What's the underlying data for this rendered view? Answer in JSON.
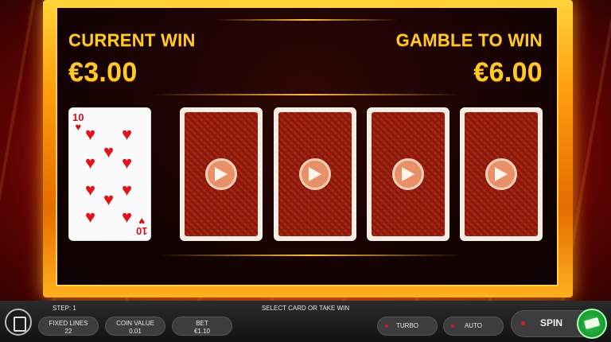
{
  "header": {
    "current_win_label": "CURRENT WIN",
    "current_win_value": "€3.00",
    "gamble_label": "GAMBLE TO WIN",
    "gamble_value": "€6.00"
  },
  "dealer_card": {
    "rank": "10",
    "suit": "hearts",
    "suit_symbol": "♥"
  },
  "face_down_cards": 4,
  "bottom_bar": {
    "step": "STEP: 1",
    "message": "SELECT CARD OR TAKE WIN",
    "fixed_lines_label": "FIXED LINES",
    "fixed_lines_value": "22",
    "coin_value_label": "COIN VALUE",
    "coin_value_value": "0.01",
    "bet_label": "BET",
    "bet_value": "€1.10",
    "turbo_label": "TURBO",
    "auto_label": "AUTO",
    "spin_label": "SPIN"
  },
  "colors": {
    "gold": "#ffc928",
    "frame": "#ff9f0f",
    "heart": "#e0151c",
    "cash_green": "#2fbf4a"
  }
}
